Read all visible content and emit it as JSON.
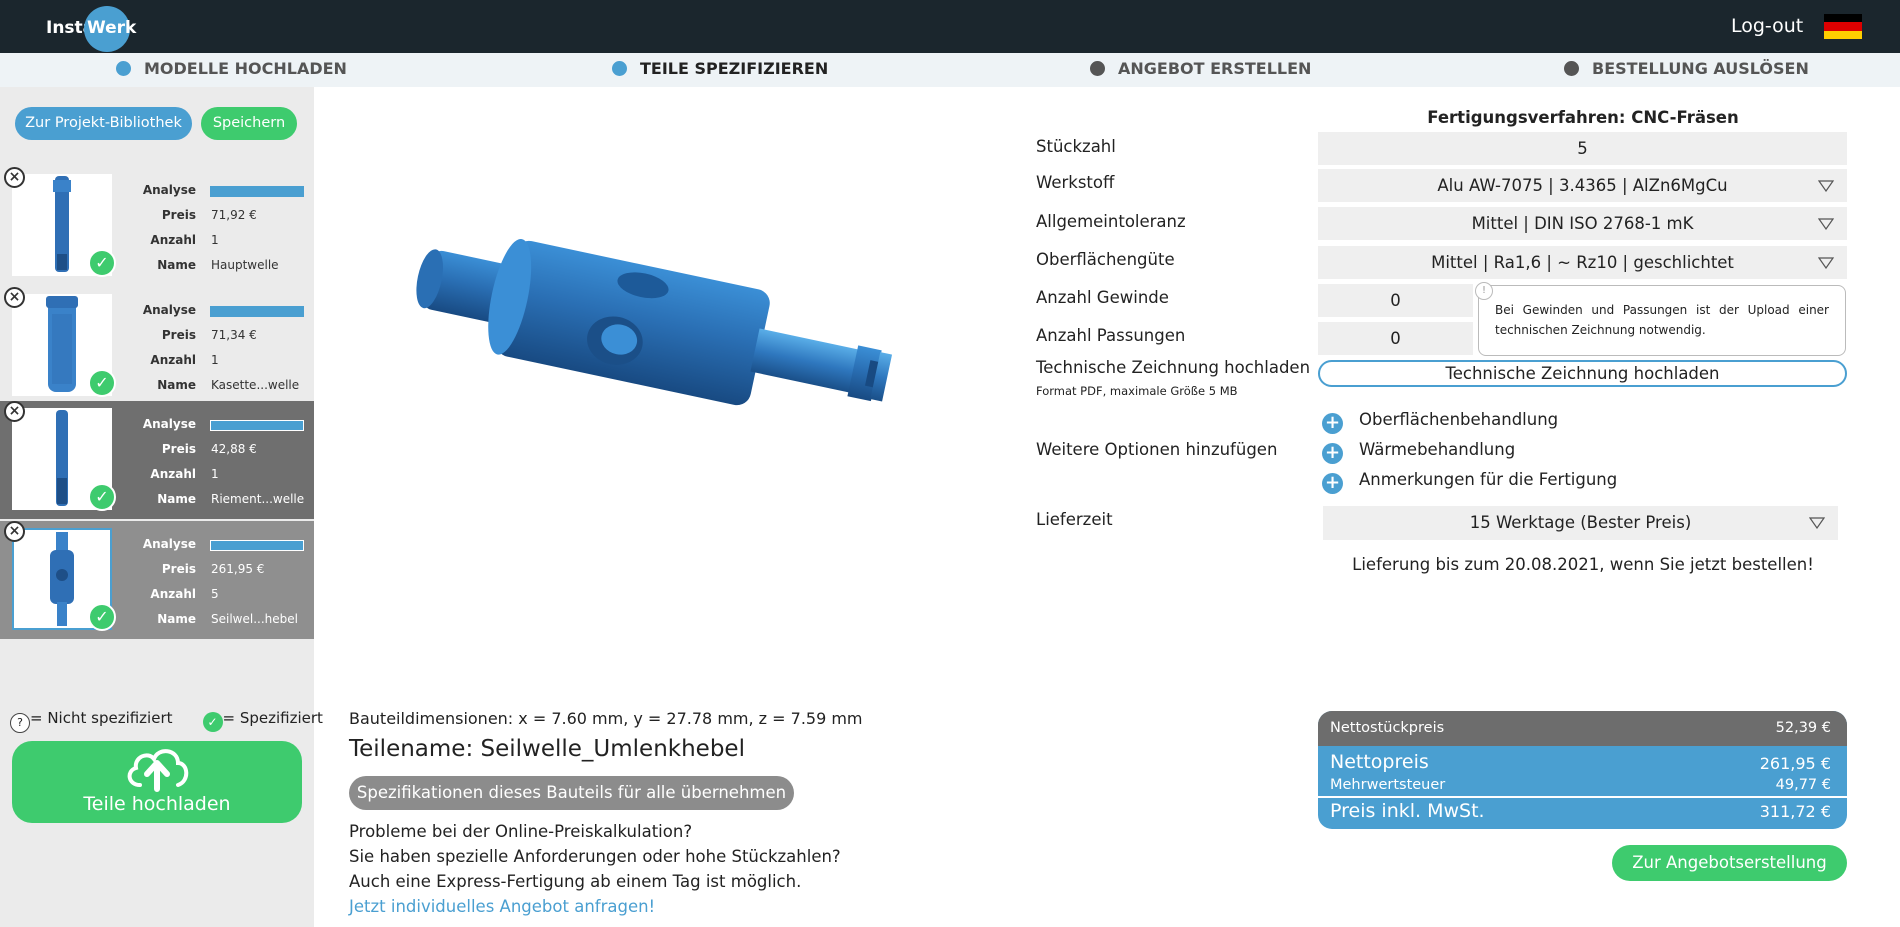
{
  "header": {
    "logo_part1": "Insta",
    "logo_part2": "Werk",
    "logout": "Log-out",
    "flag_colors": [
      "#000000",
      "#dd0000",
      "#ffce00"
    ]
  },
  "steps": [
    {
      "label": "MODELLE HOCHLADEN",
      "color": "#4a9fd1"
    },
    {
      "label": "TEILE SPEZIFIZIEREN",
      "color": "#4a9fd1"
    },
    {
      "label": "ANGEBOT ERSTELLEN",
      "color": "#555555"
    },
    {
      "label": "BESTELLUNG AUSLÖSEN",
      "color": "#555555"
    }
  ],
  "sidebar": {
    "library_button": "Zur Projekt-Bibliothek",
    "save_button": "Speichern",
    "labels": {
      "analyse": "Analyse",
      "preis": "Preis",
      "anzahl": "Anzahl",
      "name": "Name"
    },
    "parts": [
      {
        "preis": "71,92 €",
        "anzahl": "1",
        "name": "Hauptwelle"
      },
      {
        "preis": "71,34 €",
        "anzahl": "1",
        "name": "Kasette...welle"
      },
      {
        "preis": "42,88 €",
        "anzahl": "1",
        "name": "Riement...welle"
      },
      {
        "preis": "261,95 €",
        "anzahl": "5",
        "name": "Seilwel...hebel"
      }
    ],
    "legend_not_specified": "= Nicht spezifiziert",
    "legend_specified": "= Spezifiziert",
    "upload_button": "Teile hochladen"
  },
  "center": {
    "dimensions": "Bauteildimensionen: x = 7.60 mm, y = 27.78 mm, z = 7.59 mm",
    "part_name": "Teilename: Seilwelle_Umlenkhebel",
    "apply_button": "Spezifikationen dieses Bauteils für alle übernehmen",
    "problems_line1": "Probleme bei der Online-Preiskalkulation?",
    "problems_line2": "Sie haben spezielle Anforderungen oder hohe Stückzahlen?",
    "problems_line3": "Auch eine Express-Fertigung ab einem Tag ist möglich.",
    "offer_link": "Jetzt individuelles Angebot anfragen!"
  },
  "form": {
    "title": "Fertigungsverfahren: CNC-Fräsen",
    "stueckzahl_label": "Stückzahl",
    "stueckzahl_value": "5",
    "werkstoff_label": "Werkstoff",
    "werkstoff_value": "Alu AW-7075 | 3.4365 | AlZn6MgCu",
    "toleranz_label": "Allgemeintoleranz",
    "toleranz_value": "Mittel | DIN ISO 2768-1 mK",
    "oberflaeche_label": "Oberflächengüte",
    "oberflaeche_value": "Mittel | Ra1,6 | ~ Rz10 | geschlichtet",
    "gewinde_label": "Anzahl Gewinde",
    "gewinde_value": "0",
    "passungen_label": "Anzahl Passungen",
    "passungen_value": "0",
    "note": "Bei Gewinden und Passungen ist der Upload einer technischen Zeichnung notwendig.",
    "note_icon": "!",
    "tz_label": "Technische Zeichnung hochladen",
    "tz_sub": "Format PDF, maximale Größe 5 MB",
    "tz_button": "Technische Zeichnung hochladen",
    "options_label": "Weitere Optionen hinzufügen",
    "options": [
      "Oberflächenbehandlung",
      "Wärmebehandlung",
      "Anmerkungen für die Fertigung"
    ],
    "lieferzeit_label": "Lieferzeit",
    "lieferzeit_value": "15 Werktage (Bester Preis)",
    "delivery_note": "Lieferung bis zum 20.08.2021, wenn Sie jetzt bestellen!"
  },
  "prices": {
    "netto_stueck_label": "Nettostückpreis",
    "netto_stueck_value": "52,39 €",
    "netto_label": "Nettopreis",
    "netto_value": "261,95 €",
    "mwst_label": "Mehrwertsteuer",
    "mwst_value": "49,77 €",
    "brutto_label": "Preis inkl. MwSt.",
    "brutto_value": "311,72 €",
    "offer_button": "Zur Angebotserstellung"
  },
  "colors": {
    "accent_blue": "#4a9fd1",
    "accent_green": "#3ecb6e",
    "topbar": "#1b262d"
  }
}
